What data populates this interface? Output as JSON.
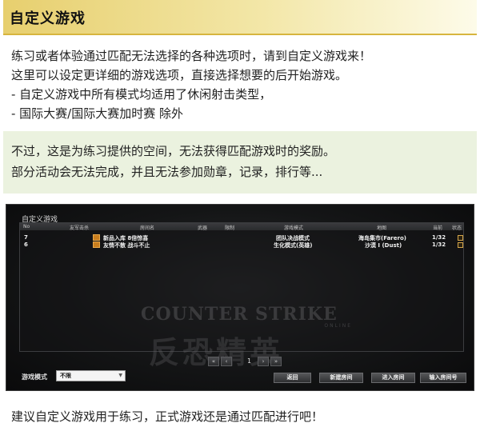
{
  "header": {
    "title": "自定义游戏"
  },
  "intro": {
    "lines": [
      "练习或者体验通过匹配无法选择的各种选项时，请到自定义游戏来！",
      "这里可以设定更详细的游戏选项，直接选择想要的后开始游戏。",
      "- 自定义游戏中所有模式均适用了休闲射击类型，",
      "- 国际大赛/国际大赛加时赛 除外"
    ]
  },
  "note": {
    "lines": [
      "不过，这是为练习提供的空间，无法获得匹配游戏时的奖励。",
      "部分活动会无法完成，并且无法参加勋章，记录，排行等..."
    ]
  },
  "game_window": {
    "title": "自定义游戏",
    "columns": {
      "no": "No",
      "friend": "友军击杀",
      "room_name": "房间名",
      "weapon": "武器",
      "limit": "限制",
      "game_mode": "游戏模式",
      "map": "地图",
      "players": "当前",
      "status": "状态"
    },
    "rows": [
      {
        "no": "7",
        "room_name": "新品入库 8倍惊喜",
        "game_mode": "团队决战模式",
        "map": "海岛集市(Farero)",
        "players": "1/32",
        "status_icon": "status-icon"
      },
      {
        "no": "6",
        "room_name": "友情不散 战斗不止",
        "game_mode": "生化模式(英雄)",
        "map": "沙漠 I (Dust)",
        "players": "1/32",
        "status_icon": "status-icon"
      }
    ],
    "watermark": {
      "brand": "COUNTER STRIKE",
      "sub": "ONLINE",
      "cn": "反恐精英"
    },
    "pager": {
      "first": "«",
      "prev": "‹",
      "page": "1",
      "next": "›",
      "last": "»"
    },
    "mode_filter": {
      "label": "游戏模式",
      "selected": "不限"
    },
    "buttons": {
      "back": "返回",
      "create": "新建房间",
      "enter": "进入房间",
      "enter_number": "输入房间号"
    }
  },
  "footer": {
    "text": "建议自定义游戏用于练习，正式游戏还是通过匹配进行吧！"
  },
  "colors": {
    "header_gold": "#e7cf6e",
    "note_green": "#ebf2df",
    "game_bg": "#0c0c0d"
  }
}
